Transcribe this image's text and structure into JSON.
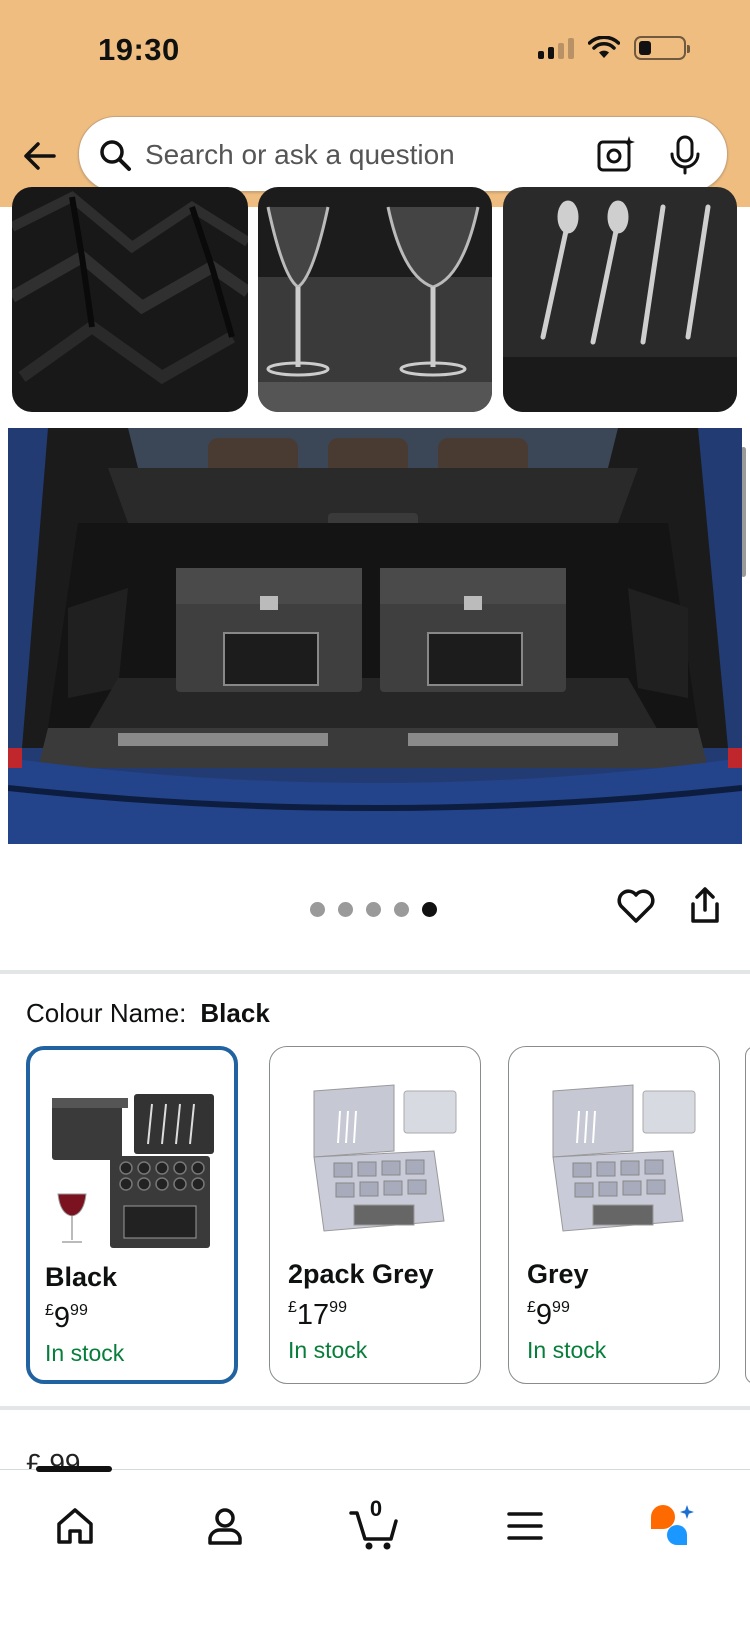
{
  "status_bar": {
    "time": "19:30"
  },
  "search": {
    "placeholder": "Search or ask a question"
  },
  "gallery": {
    "page_count": 5,
    "active_index": 4
  },
  "colour": {
    "label": "Colour Name:",
    "selected": "Black",
    "options": [
      {
        "name": "Black",
        "currency": "£",
        "whole": "9",
        "fraction": "99",
        "stock": "In stock",
        "selected": true
      },
      {
        "name": "2pack Grey",
        "currency": "£",
        "whole": "17",
        "fraction": "99",
        "stock": "In stock",
        "selected": false
      },
      {
        "name": "Grey",
        "currency": "£",
        "whole": "9",
        "fraction": "99",
        "stock": "In stock",
        "selected": false
      }
    ]
  },
  "partial_price": {
    "text": "£ 99"
  },
  "bottom_nav": {
    "items": [
      "home-icon",
      "account-icon",
      "cart-icon",
      "menu-icon",
      "rufus-assistant-icon"
    ],
    "cart_count": "0"
  },
  "colors": {
    "header_bg": "#efbd80",
    "selected_border": "#2162a1",
    "in_stock": "#067d3a",
    "assistant_orange": "#ff6a00",
    "assistant_blue": "#1a98ff"
  }
}
